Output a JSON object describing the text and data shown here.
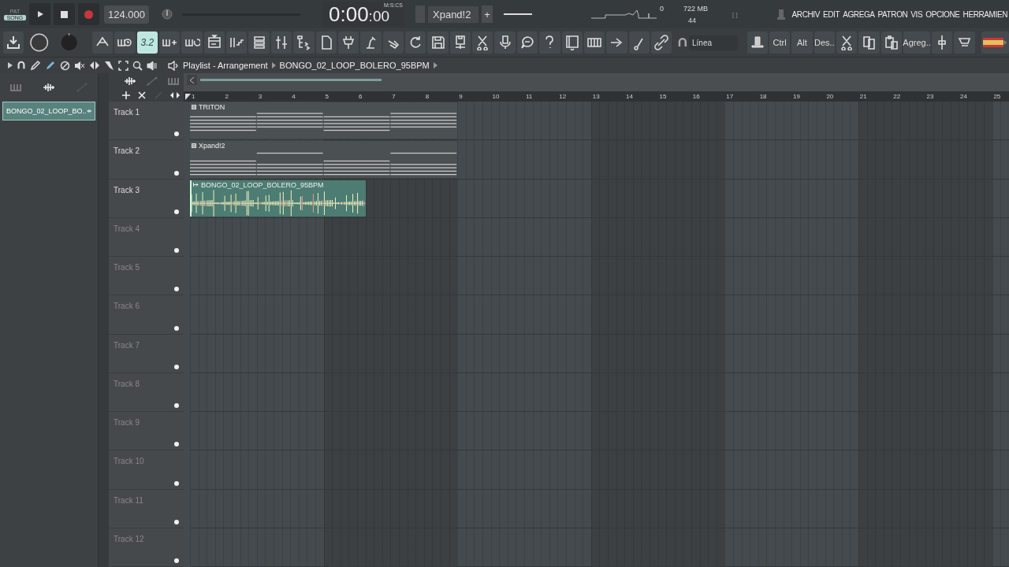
{
  "transport": {
    "modes": [
      {
        "label": "PAT",
        "selected": false
      },
      {
        "label": "SONG",
        "selected": true
      }
    ],
    "recording": false,
    "tempo": "124.000",
    "position": {
      "level": 0
    },
    "time_main": "0:00",
    "time_cs": ":00",
    "time_format": "M:S:CS",
    "pattern": "Xpand!2",
    "pattern_add": "+",
    "volume": {
      "level": 1
    },
    "cpu": "0",
    "memory": "722 MB",
    "polyphony": "44",
    "hint": "[ ]"
  },
  "menu": [
    "ARCHIV",
    "EDIT",
    "AGREGA",
    "PATRON",
    "VIS",
    "OPCIONE",
    "HERRAMIEN"
  ],
  "toolbar": {
    "typing_keyboard": {
      "label": "3.2",
      "selected": true
    },
    "snap": {
      "label": "Línea"
    },
    "modifiers": [
      "Ctrl",
      "Alt",
      "Des.."
    ],
    "add": "Agreg.."
  },
  "breadcrumb": [
    "Playlist - Arrangement",
    "BONGO_02_LOOP_BOLERO_95BPM"
  ],
  "picker": [
    {
      "label": "BONGO_02_LOOP_BO..",
      "selected": true
    }
  ],
  "ruler": [
    "1",
    "2",
    "3",
    "4",
    "5",
    "6",
    "7",
    "8",
    "9",
    "10",
    "11",
    "12",
    "13",
    "14",
    "15",
    "16",
    "17",
    "18",
    "19",
    "20",
    "21",
    "22",
    "23",
    "24",
    "25"
  ],
  "tracks": [
    {
      "name": "Track 1",
      "clips": [
        {
          "kind": "pattern",
          "name": "TRITON"
        }
      ]
    },
    {
      "name": "Track 2",
      "clips": [
        {
          "kind": "pattern",
          "name": "Xpand!2"
        }
      ]
    },
    {
      "name": "Track 3",
      "clips": [
        {
          "kind": "audio",
          "name": "BONGO_02_LOOP_BOLERO_95BPM"
        }
      ]
    },
    {
      "name": "Track 4"
    },
    {
      "name": "Track 5"
    },
    {
      "name": "Track 6"
    },
    {
      "name": "Track 7"
    },
    {
      "name": "Track 8"
    },
    {
      "name": "Track 9"
    },
    {
      "name": "Track 10"
    },
    {
      "name": "Track 11"
    },
    {
      "name": "Track 12"
    }
  ]
}
